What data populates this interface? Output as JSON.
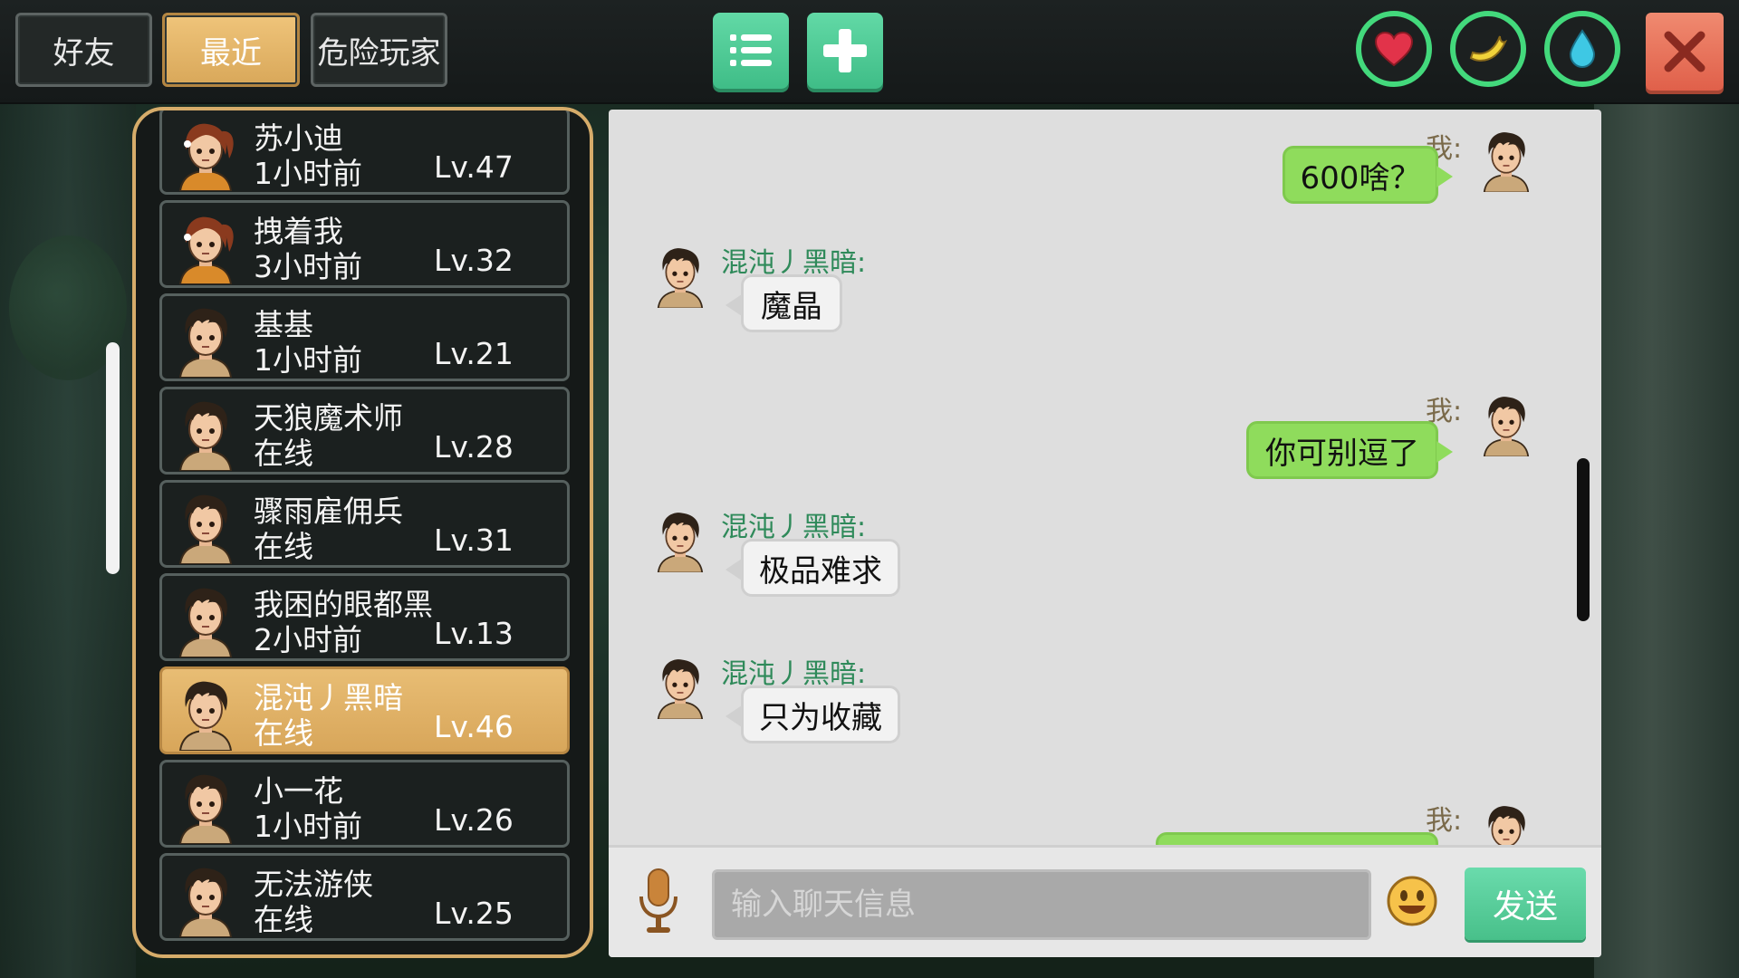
{
  "tabs": {
    "friends": "好友",
    "recent": "最近",
    "danger": "危险玩家"
  },
  "icons": {
    "list": "list-icon",
    "add": "plus-icon",
    "heart": "heart-icon",
    "food": "banana-icon",
    "water": "water-drop-icon",
    "close": "close-icon",
    "mic": "microphone-icon",
    "emoji": "smiley-icon"
  },
  "colors": {
    "accent_gold": "#d9a85a",
    "accent_green": "#48c08a",
    "stat_ring": "#43d97c",
    "close_red": "#e0604a",
    "sender_green": "#2f8a5a",
    "my_bubble": "#8fdc5c"
  },
  "friends": [
    {
      "name": "苏小迪",
      "status": "1小时前",
      "level": "Lv.47",
      "avatar": "female"
    },
    {
      "name": "拽着我",
      "status": "3小时前",
      "level": "Lv.32",
      "avatar": "female"
    },
    {
      "name": "基基",
      "status": "1小时前",
      "level": "Lv.21",
      "avatar": "male"
    },
    {
      "name": "天狼魔术师",
      "status": "在线",
      "level": "Lv.28",
      "avatar": "male"
    },
    {
      "name": "骤雨雇佣兵",
      "status": "在线",
      "level": "Lv.31",
      "avatar": "male"
    },
    {
      "name": "我困的眼都黑",
      "status": "2小时前",
      "level": "Lv.13",
      "avatar": "male"
    },
    {
      "name": "混沌丿黑暗",
      "status": "在线",
      "level": "Lv.46",
      "avatar": "male",
      "selected": true
    },
    {
      "name": "小一花",
      "status": "1小时前",
      "level": "Lv.26",
      "avatar": "male"
    },
    {
      "name": "无法游侠",
      "status": "在线",
      "level": "Lv.25",
      "avatar": "male"
    }
  ],
  "chat": {
    "messages": [
      {
        "dir": "out",
        "sender": "我:",
        "text": "600啥？"
      },
      {
        "dir": "in",
        "sender": "混沌丿黑暗:",
        "text": "魔晶"
      },
      {
        "dir": "out",
        "sender": "我:",
        "text": "你可别逗了"
      },
      {
        "dir": "in",
        "sender": "混沌丿黑暗:",
        "text": "极品难求"
      },
      {
        "dir": "in",
        "sender": "混沌丿黑暗:",
        "text": "只为收藏"
      },
      {
        "dir": "out",
        "sender": "我:",
        "text": ""
      }
    ],
    "input_placeholder": "输入聊天信息",
    "send_label": "发送"
  }
}
